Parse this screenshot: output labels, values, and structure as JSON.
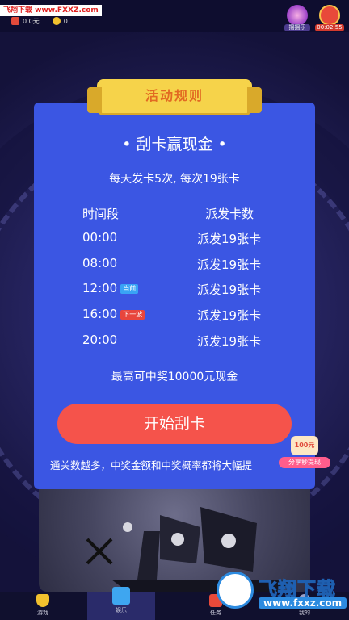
{
  "status_bar": {
    "site_tag": "飞翔下载 www.FXXZ.com",
    "cash": "0.0元",
    "coins": "0"
  },
  "top_right": {
    "shake_label": "摇摇乐",
    "timer_label": "00:02:55"
  },
  "ribbon": {
    "title": "活动规则"
  },
  "card": {
    "title": "• 刮卡赢现金 •",
    "subtitle": "每天发卡5次, 每次19张卡",
    "header_time": "时间段",
    "header_cards": "派发卡数",
    "rows": [
      {
        "time": "00:00",
        "cards": "派发19张卡",
        "tag": ""
      },
      {
        "time": "08:00",
        "cards": "派发19张卡",
        "tag": ""
      },
      {
        "time": "12:00",
        "cards": "派发19张卡",
        "tag": "当前"
      },
      {
        "time": "16:00",
        "cards": "派发19张卡",
        "tag": "下一波"
      },
      {
        "time": "20:00",
        "cards": "派发19张卡",
        "tag": ""
      }
    ],
    "max_prize": "最高可中奖10000元现金",
    "start_button": "开始刮卡",
    "footer_note": "通关数越多，中奖金额和中奖概率都将大幅提"
  },
  "share_badge": {
    "amount": "100元",
    "label": "分享秒提现"
  },
  "bottom_nav": [
    {
      "label": "游戏",
      "icon": "trophy-icon"
    },
    {
      "label": "娱乐",
      "icon": "gift-icon"
    },
    {
      "label": "任务",
      "icon": "task-icon"
    },
    {
      "label": "我的",
      "icon": "user-icon"
    }
  ],
  "watermark": {
    "text": "飞翔下载",
    "url": "www.fxxz.com"
  },
  "colors": {
    "card": "#3b56e3",
    "button": "#f5534b",
    "ribbon": "#f6d34a",
    "ribbon_text": "#e26a22"
  }
}
